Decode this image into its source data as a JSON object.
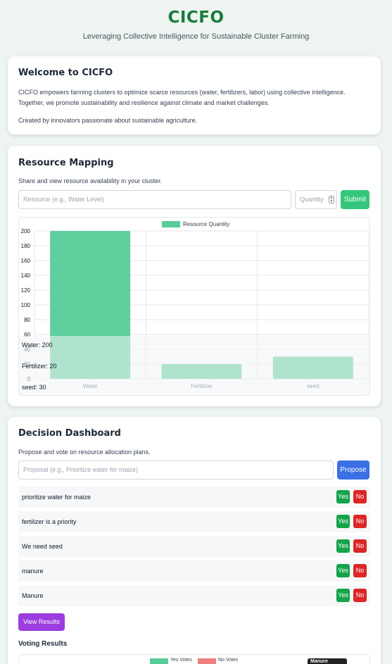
{
  "header": {
    "title": "CICFO",
    "tagline": "Leveraging Collective Intelligence for Sustainable Cluster Farming"
  },
  "welcome": {
    "title": "Welcome to CICFO",
    "body": "CICFO empowers farming clusters to optimize scarce resources (water, fertilizers, labor) using collective intelligence. Together, we promote sustainability and resilience against climate and market challenges.",
    "credit": "Created by innovators passionate about sustainable agriculture."
  },
  "resources": {
    "title": "Resource Mapping",
    "description": "Share and view resource availability in your cluster.",
    "resource_placeholder": "Resource (e.g., Water Level)",
    "quantity_placeholder": "Quantity",
    "submit_label": "Submit",
    "summary": [
      "Water: 200",
      "Fertilizer: 20",
      "seed: 30"
    ]
  },
  "chart_data": {
    "type": "bar",
    "categories": [
      "Water",
      "Fertilizer",
      "seed"
    ],
    "series": [
      {
        "name": "Resource Quantity",
        "values": [
          200,
          20,
          30
        ],
        "color": "#57cc99"
      }
    ],
    "ylim": [
      0,
      200
    ],
    "yticks": [
      0,
      20,
      40,
      60,
      80,
      100,
      120,
      140,
      160,
      180,
      200
    ],
    "grid": true,
    "legend": "top-center"
  },
  "decision": {
    "title": "Decision Dashboard",
    "description": "Propose and vote on resource allocation plans.",
    "proposal_placeholder": "Proposal (e.g., Prioritize water for maize)",
    "propose_label": "Propose",
    "proposals": [
      {
        "label": "prioritize water for maize",
        "yes": "Yes",
        "no": "No"
      },
      {
        "label": "fertilizer is a priority",
        "yes": "Yes",
        "no": "No"
      },
      {
        "label": "We need seed",
        "yes": "Yes",
        "no": "No"
      },
      {
        "label": "manure",
        "yes": "Yes",
        "no": "No"
      },
      {
        "label": "Manure",
        "yes": "Yes",
        "no": "No"
      }
    ],
    "view_results_label": "View Results",
    "voting_results_title": "Voting Results",
    "legend_yes": "Yes Votes",
    "legend_no": "No Votes",
    "tooltip": "Manure",
    "colors": {
      "yes": "#57cc99",
      "no": "#f08080"
    }
  }
}
